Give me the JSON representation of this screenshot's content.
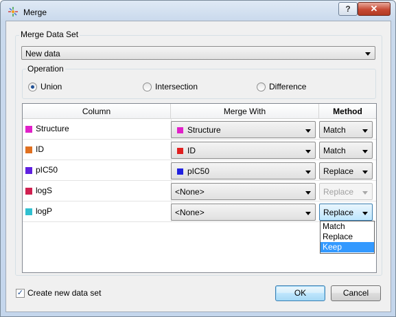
{
  "window": {
    "title": "Merge",
    "help_label": "?",
    "close_label": "✕"
  },
  "merge_data_set": {
    "title": "Merge Data Set",
    "selected": "New data",
    "operation": {
      "title": "Operation",
      "options": [
        "Union",
        "Intersection",
        "Difference"
      ],
      "selected": "Union"
    }
  },
  "table": {
    "headers": [
      "Column",
      "Merge With",
      "Method"
    ],
    "rows": [
      {
        "column": "Structure",
        "column_color": "#e020c8",
        "merge_with": "Structure",
        "merge_color": "#e020c8",
        "method": "Match",
        "method_enabled": true
      },
      {
        "column": "ID",
        "column_color": "#e07020",
        "merge_with": "ID",
        "merge_color": "#e02020",
        "method": "Match",
        "method_enabled": true
      },
      {
        "column": "pIC50",
        "column_color": "#6020e0",
        "merge_with": "pIC50",
        "merge_color": "#2020e0",
        "method": "Replace",
        "method_enabled": true
      },
      {
        "column": "logS",
        "column_color": "#d02050",
        "merge_with": "<None>",
        "merge_color": "",
        "method": "Replace",
        "method_enabled": false
      },
      {
        "column": "logP",
        "column_color": "#30c0d0",
        "merge_with": "<None>",
        "merge_color": "",
        "method": "Replace",
        "method_enabled": true
      }
    ],
    "method_dropdown": {
      "options": [
        "Match",
        "Replace",
        "Keep"
      ],
      "highlighted": "Keep"
    }
  },
  "footer": {
    "create_new_label": "Create new data set",
    "create_new_checked": true,
    "ok_label": "OK",
    "cancel_label": "Cancel"
  }
}
